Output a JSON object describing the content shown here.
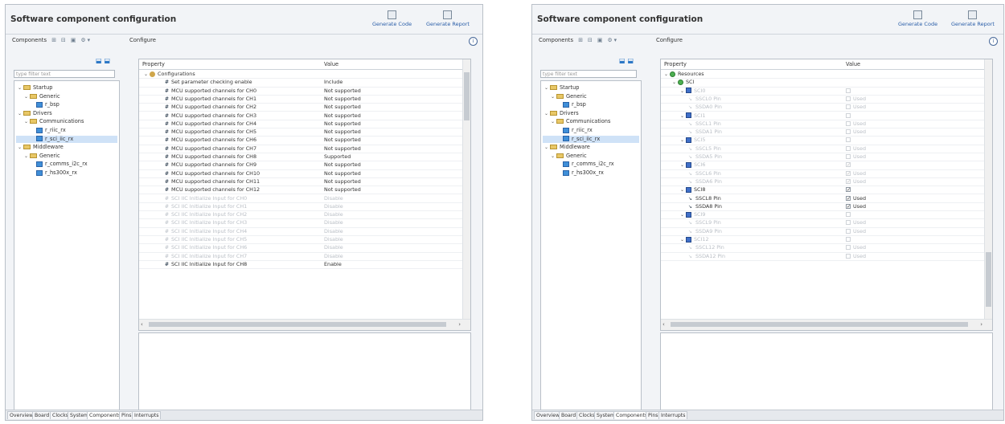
{
  "window_title": "Software component configuration",
  "toolbar": {
    "generate_code": "Generate Code",
    "generate_report": "Generate Report"
  },
  "components_label": "Components",
  "configure_label": "Configure",
  "filter_placeholder": "type filter text",
  "tree": [
    {
      "label": "Startup",
      "level": 0,
      "kind": "folder",
      "expanded": true
    },
    {
      "label": "Generic",
      "level": 1,
      "kind": "folder",
      "expanded": true
    },
    {
      "label": "r_bsp",
      "level": 2,
      "kind": "component"
    },
    {
      "label": "Drivers",
      "level": 0,
      "kind": "folder",
      "expanded": true
    },
    {
      "label": "Communications",
      "level": 1,
      "kind": "folder",
      "expanded": true
    },
    {
      "label": "r_riic_rx",
      "level": 2,
      "kind": "component"
    },
    {
      "label": "r_sci_iic_rx",
      "level": 2,
      "kind": "component",
      "selected": true
    },
    {
      "label": "Middleware",
      "level": 0,
      "kind": "folder",
      "expanded": true
    },
    {
      "label": "Generic",
      "level": 1,
      "kind": "folder",
      "expanded": true
    },
    {
      "label": "r_comms_i2c_rx",
      "level": 2,
      "kind": "component"
    },
    {
      "label": "r_hs300x_rx",
      "level": 2,
      "kind": "component"
    }
  ],
  "left_table": {
    "headers": [
      "Property",
      "Value"
    ],
    "rows": [
      {
        "property": "Configurations",
        "value": "",
        "kind": "group",
        "level": 0
      },
      {
        "property": "Set parameter checking enable",
        "value": "Include",
        "level": 1
      },
      {
        "property": "MCU supported channels for CH0",
        "value": "Not supported",
        "level": 1
      },
      {
        "property": "MCU supported channels for CH1",
        "value": "Not supported",
        "level": 1
      },
      {
        "property": "MCU supported channels for CH2",
        "value": "Not supported",
        "level": 1
      },
      {
        "property": "MCU supported channels for CH3",
        "value": "Not supported",
        "level": 1
      },
      {
        "property": "MCU supported channels for CH4",
        "value": "Not supported",
        "level": 1
      },
      {
        "property": "MCU supported channels for CH5",
        "value": "Not supported",
        "level": 1
      },
      {
        "property": "MCU supported channels for CH6",
        "value": "Not supported",
        "level": 1
      },
      {
        "property": "MCU supported channels for CH7",
        "value": "Not supported",
        "level": 1
      },
      {
        "property": "MCU supported channels for CH8",
        "value": "Supported",
        "level": 1
      },
      {
        "property": "MCU supported channels for CH9",
        "value": "Not supported",
        "level": 1
      },
      {
        "property": "MCU supported channels for CH10",
        "value": "Not supported",
        "level": 1
      },
      {
        "property": "MCU supported channels for CH11",
        "value": "Not supported",
        "level": 1
      },
      {
        "property": "MCU supported channels for CH12",
        "value": "Not supported",
        "level": 1
      },
      {
        "property": "SCI IIC Initialize Input for CH0",
        "value": "Disable",
        "level": 1,
        "disabled": true
      },
      {
        "property": "SCI IIC Initialize Input for CH1",
        "value": "Disable",
        "level": 1,
        "disabled": true
      },
      {
        "property": "SCI IIC Initialize Input for CH2",
        "value": "Disable",
        "level": 1,
        "disabled": true
      },
      {
        "property": "SCI IIC Initialize Input for CH3",
        "value": "Disable",
        "level": 1,
        "disabled": true
      },
      {
        "property": "SCI IIC Initialize Input for CH4",
        "value": "Disable",
        "level": 1,
        "disabled": true
      },
      {
        "property": "SCI IIC Initialize Input for CH5",
        "value": "Disable",
        "level": 1,
        "disabled": true
      },
      {
        "property": "SCI IIC Initialize Input for CH6",
        "value": "Disable",
        "level": 1,
        "disabled": true
      },
      {
        "property": "SCI IIC Initialize Input for CH7",
        "value": "Disable",
        "level": 1,
        "disabled": true
      },
      {
        "property": "SCI IIC Initialize Input for CH8",
        "value": "Enable",
        "level": 1
      }
    ]
  },
  "right_table": {
    "headers": [
      "Property",
      "Value"
    ],
    "rows": [
      {
        "property": "Resources",
        "value": "",
        "kind": "resource",
        "level": 0
      },
      {
        "property": "SCI",
        "value": "",
        "kind": "resource",
        "level": 1
      },
      {
        "property": "SCI0",
        "value": "",
        "kind": "channel",
        "level": 2,
        "disabled": true,
        "checked": false
      },
      {
        "property": "SSCL0 Pin",
        "value": "Used",
        "kind": "pin",
        "level": 3,
        "disabled": true,
        "checked": false
      },
      {
        "property": "SSDA0 Pin",
        "value": "Used",
        "kind": "pin",
        "level": 3,
        "disabled": true,
        "checked": false
      },
      {
        "property": "SCI1",
        "value": "",
        "kind": "channel",
        "level": 2,
        "disabled": true,
        "checked": false
      },
      {
        "property": "SSCL1 Pin",
        "value": "Used",
        "kind": "pin",
        "level": 3,
        "disabled": true,
        "checked": false
      },
      {
        "property": "SSDA1 Pin",
        "value": "Used",
        "kind": "pin",
        "level": 3,
        "disabled": true,
        "checked": false
      },
      {
        "property": "SCI5",
        "value": "",
        "kind": "channel",
        "level": 2,
        "disabled": true,
        "checked": false
      },
      {
        "property": "SSCL5 Pin",
        "value": "Used",
        "kind": "pin",
        "level": 3,
        "disabled": true,
        "checked": false
      },
      {
        "property": "SSDA5 Pin",
        "value": "Used",
        "kind": "pin",
        "level": 3,
        "disabled": true,
        "checked": false
      },
      {
        "property": "SCI6",
        "value": "",
        "kind": "channel",
        "level": 2,
        "disabled": true,
        "checked": true
      },
      {
        "property": "SSCL6 Pin",
        "value": "Used",
        "kind": "pin",
        "level": 3,
        "disabled": true,
        "checked": true
      },
      {
        "property": "SSDA6 Pin",
        "value": "Used",
        "kind": "pin",
        "level": 3,
        "disabled": true,
        "checked": true
      },
      {
        "property": "SCI8",
        "value": "",
        "kind": "channel",
        "level": 2,
        "checked": true
      },
      {
        "property": "SSCL8 Pin",
        "value": "Used",
        "kind": "pin",
        "level": 3,
        "checked": true
      },
      {
        "property": "SSDA8 Pin",
        "value": "Used",
        "kind": "pin",
        "level": 3,
        "checked": true
      },
      {
        "property": "SCI9",
        "value": "",
        "kind": "channel",
        "level": 2,
        "disabled": true,
        "checked": false
      },
      {
        "property": "SSCL9 Pin",
        "value": "Used",
        "kind": "pin",
        "level": 3,
        "disabled": true,
        "checked": false
      },
      {
        "property": "SSDA9 Pin",
        "value": "Used",
        "kind": "pin",
        "level": 3,
        "disabled": true,
        "checked": false
      },
      {
        "property": "SCI12",
        "value": "",
        "kind": "channel",
        "level": 2,
        "disabled": true,
        "checked": false
      },
      {
        "property": "SSCL12 Pin",
        "value": "Used",
        "kind": "pin",
        "level": 3,
        "disabled": true,
        "checked": false
      },
      {
        "property": "SSDA12 Pin",
        "value": "Used",
        "kind": "pin",
        "level": 3,
        "disabled": true,
        "checked": false
      }
    ]
  },
  "bottom_tabs": [
    "Overview",
    "Board",
    "Clocks",
    "System",
    "Components",
    "Pins",
    "Interrupts"
  ],
  "active_tab": "Components",
  "colors": {
    "selection": "#cfe2f7",
    "folder": "#e8c766",
    "component": "#3f8fd8",
    "resource": "#4caf50",
    "channel": "#3f6fc8",
    "link": "#2a5ea8"
  }
}
